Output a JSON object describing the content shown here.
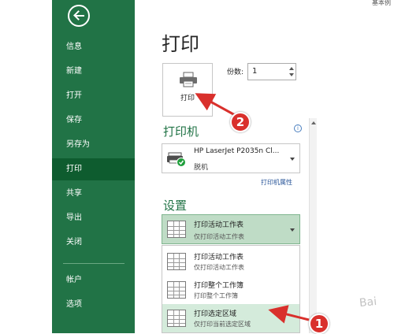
{
  "header": {
    "top_hint": "基本例"
  },
  "sidebar": {
    "items": [
      {
        "label": "信息"
      },
      {
        "label": "新建"
      },
      {
        "label": "打开"
      },
      {
        "label": "保存"
      },
      {
        "label": "另存为"
      },
      {
        "label": "打印"
      },
      {
        "label": "共享"
      },
      {
        "label": "导出"
      },
      {
        "label": "关闭"
      },
      {
        "label": "帐户"
      },
      {
        "label": "选项"
      }
    ],
    "active_item": "打印"
  },
  "main": {
    "title": "打印",
    "print_button_label": "打印",
    "copies_label": "份数:",
    "copies_value": "1",
    "printer_section_title": "打印机",
    "printer_name": "HP LaserJet P2035n Cl...",
    "printer_status": "脱机",
    "printer_properties_link": "打印机属性",
    "settings_section_title": "设置",
    "selected_scope": {
      "title": "打印活动工作表",
      "subtitle": "仅打印活动工作表"
    },
    "scope_options": [
      {
        "title": "打印活动工作表",
        "subtitle": "仅打印活动工作表"
      },
      {
        "title": "打印整个工作簿",
        "subtitle": "打印整个工作簿"
      },
      {
        "title": "打印选定区域",
        "subtitle": "仅打印当前选定区域"
      }
    ]
  },
  "annotations": {
    "callout_1": "1",
    "callout_2": "2",
    "watermark": "Bai"
  },
  "colors": {
    "brand_green": "#217346",
    "active_nav": "#0e5c2f",
    "callout_red": "#d9302c",
    "link_blue": "#2b579a"
  },
  "icons": [
    "back-arrow-icon",
    "printer-icon",
    "info-icon",
    "sheet-icon",
    "chevron-down-icon"
  ]
}
